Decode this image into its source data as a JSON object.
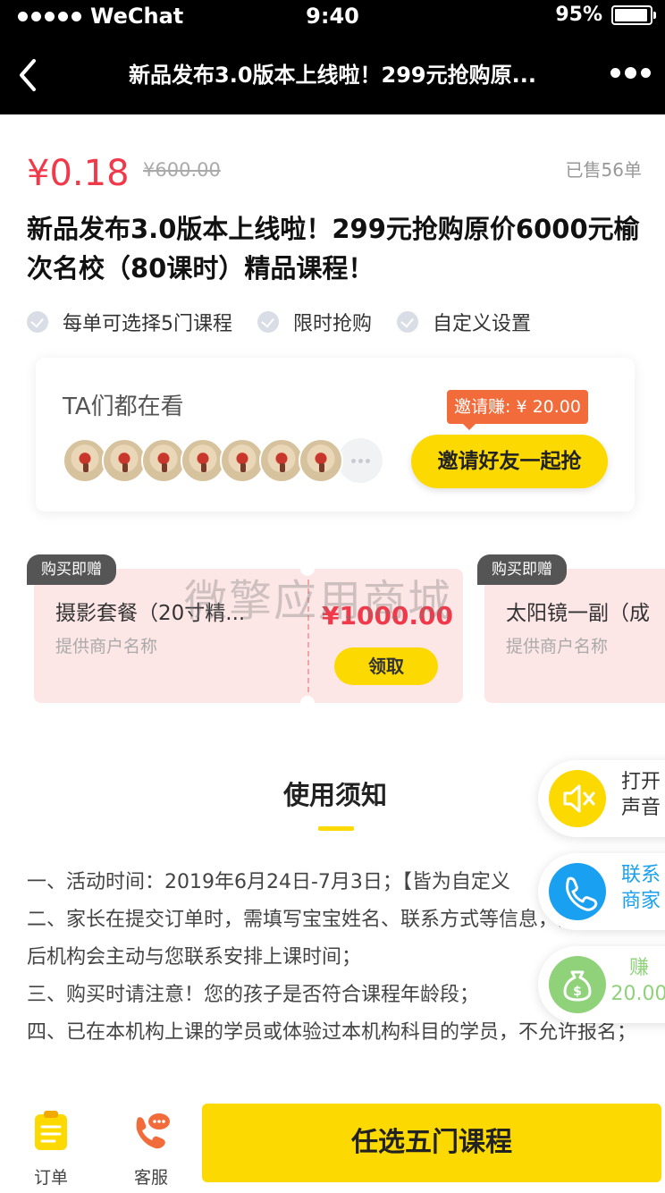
{
  "status_bar": {
    "carrier": "WeChat",
    "time": "9:40",
    "battery": "95%"
  },
  "nav": {
    "title": "新品发布3.0版本上线啦！299元抢购原..."
  },
  "product": {
    "price": "¥0.18",
    "original_price": "¥600.00",
    "sold": "已售56单",
    "title": "新品发布3.0版本上线啦！299元抢购原价6000元榆次名校（80课时）精品课程！",
    "features": [
      "每单可选择5门课程",
      "限时抢购",
      "自定义设置"
    ]
  },
  "watchers": {
    "title": "TA们都在看",
    "avatar_count": 7,
    "invite_tag": "邀请赚: ¥ 20.00",
    "invite_button": "邀请好友一起抢"
  },
  "gifts": [
    {
      "tag": "购买即赠",
      "name": "摄影套餐（20寸精...",
      "merchant": "提供商户名称",
      "value": "¥1000.00",
      "button": "领取"
    },
    {
      "tag": "购买即赠",
      "name": "太阳镜一副（成",
      "merchant": "提供商户名称"
    }
  ],
  "watermark": "微擎应用商城",
  "notice": {
    "title": "使用须知",
    "items": [
      "一、活动时间：2019年6月24日-7月3日；【皆为自定义",
      "二、家长在提交订单时，需填写宝宝姓名、联系方式等信息，活动结束后机构会主动与您联系安排上课时间；",
      "三、购买时请注意！您的孩子是否符合课程年龄段；",
      "四、已在本机构上课的学员或体验过本机构科目的学员，不允许报名；"
    ]
  },
  "floating": {
    "sound": {
      "line1": "打开",
      "line2": "声音"
    },
    "contact": {
      "line1": "联系",
      "line2": "商家"
    },
    "earn": {
      "line1": "赚",
      "line2": "20.00"
    }
  },
  "bottom": {
    "orders_label": "订单",
    "service_label": "客服",
    "buy_button": "任选五门课程"
  },
  "colors": {
    "accent": "#fcd900",
    "price": "#f0394a",
    "sound_icon_bg": "#fcd900",
    "contact_icon_bg": "#1aa0f0",
    "earn_icon_bg": "#8fd27a"
  }
}
